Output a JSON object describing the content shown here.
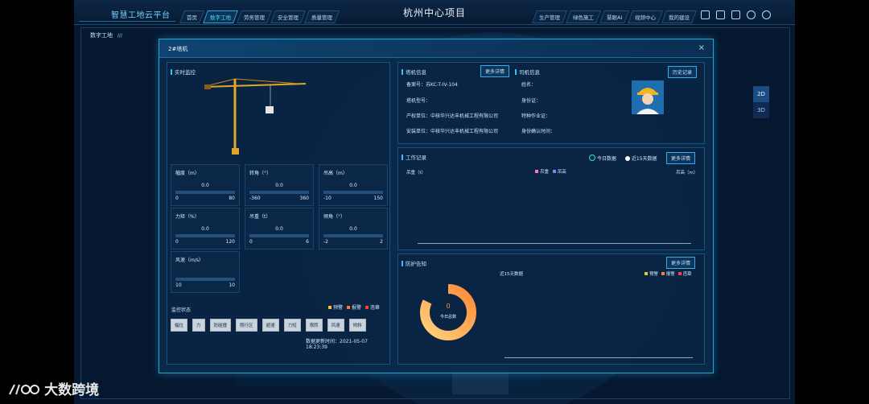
{
  "app": {
    "brand": "智慧工地云平台",
    "project_title": "杭州中心项目"
  },
  "nav_left": [
    "首页",
    "数字工地",
    "劳务管理",
    "安全管理",
    "质量管理"
  ],
  "nav_left_active": 1,
  "nav_right": [
    "生产管理",
    "绿色施工",
    "慧眼AI",
    "视频中心",
    "我的建设"
  ],
  "toolbar_icons": [
    "monitor-icon",
    "tablet-icon",
    "checklist-icon",
    "gear-icon",
    "power-icon"
  ],
  "sub_header": {
    "label": "数字工地",
    "slashes": "///"
  },
  "view_toggle": {
    "d2": "2D",
    "d3": "3D",
    "active": "2D"
  },
  "modal": {
    "title": "2#塔机",
    "close": "×"
  },
  "realtime": {
    "title": "实时监控",
    "gauges": [
      {
        "label": "幅度（m）",
        "value": "0.0",
        "min": "0",
        "max": "80"
      },
      {
        "label": "转角（°）",
        "value": "0.0",
        "min": "-360",
        "max": "360"
      },
      {
        "label": "吊高（m）",
        "value": "0.0",
        "min": "-10",
        "max": "150"
      },
      {
        "label": "力矩（%）",
        "value": "0.0",
        "min": "0",
        "max": "120"
      },
      {
        "label": "吊重（t）",
        "value": "0.0",
        "min": "0",
        "max": "6"
      },
      {
        "label": "倾角（°）",
        "value": "0.0",
        "min": "-2",
        "max": "2"
      },
      {
        "label": "风速（m/s）",
        "value": "",
        "min": "10",
        "max": "10"
      }
    ],
    "status": {
      "title": "监控状态",
      "legend": [
        {
          "label": "预警",
          "color": "#f0c040"
        },
        {
          "label": "报警",
          "color": "#ff7a2e"
        },
        {
          "label": "违章",
          "color": "#ff3b3b"
        }
      ],
      "buttons": [
        "幅位",
        "力",
        "防碰撞",
        "限行区",
        "超速",
        "力短",
        "限转",
        "风速",
        "倾斜"
      ],
      "updated_label": "数据更新时间：",
      "updated_time": "2021-05-07 18:23:39"
    }
  },
  "crane_info": {
    "title": "塔机信息",
    "more_btn": "更多详情",
    "fields": [
      {
        "label": "备案号：",
        "value": "苏KC-T-IV-104"
      },
      {
        "label": "塔机型号：",
        "value": ""
      },
      {
        "label": "产权单位：",
        "value": "中核华兴达丰机械工程有限公司"
      },
      {
        "label": "安装单位：",
        "value": "中核华兴达丰机械工程有限公司"
      }
    ]
  },
  "driver_info": {
    "title": "司机信息",
    "history_btn": "历史记录",
    "fields": [
      {
        "label": "姓名："
      },
      {
        "label": "身份证："
      },
      {
        "label": "特种作业证："
      },
      {
        "label": "身份确认时间："
      }
    ]
  },
  "work_record": {
    "title": "工作记录",
    "radio_today": "今日数据",
    "radio_15": "近15天数据",
    "more_btn": "更多详情",
    "y_left": "吊重（t）",
    "y_right": "吊高（m）",
    "legend": [
      {
        "label": "吊重",
        "color": "#ff6fd8"
      },
      {
        "label": "吊高",
        "color": "#6f8cff"
      }
    ]
  },
  "alerts": {
    "title": "防护告知",
    "subtitle": "近15天数据",
    "more_btn": "更多详情",
    "legend": [
      {
        "label": "预警",
        "color": "#f0c040"
      },
      {
        "label": "报警",
        "color": "#ff7a2e"
      },
      {
        "label": "违章",
        "color": "#ff3b3b"
      }
    ],
    "donut_value": "0",
    "donut_label": "今日总数"
  },
  "watermark": "大数跨境"
}
